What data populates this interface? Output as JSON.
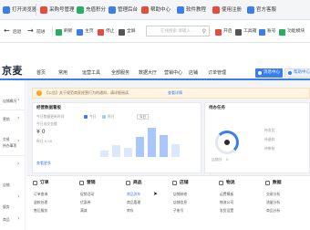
{
  "favorites": [
    {
      "label": "打开浏览器",
      "color": "#3a7cf2"
    },
    {
      "label": "采购号管理",
      "color": "#e64b3c"
    },
    {
      "label": "充值积分",
      "color": "#27ae60"
    },
    {
      "label": "管理后台",
      "color": "#3a7cf2"
    },
    {
      "label": "帮助中心",
      "color": "#e64b3c"
    },
    {
      "label": "软件教程",
      "color": "#3a7cf2"
    },
    {
      "label": "使用注册",
      "color": "#e64b3c"
    },
    {
      "label": "官方客服",
      "color": "#3a7cf2"
    }
  ],
  "toolbar": {
    "back_label": "后退",
    "forward_label": "前进",
    "items": [
      {
        "label": "刷新",
        "color": "#27ae60"
      },
      {
        "label": "主页",
        "color": "#3a7cf2"
      },
      {
        "label": "停止",
        "color": "#e64b3c"
      },
      {
        "label": "全屏",
        "color": "#555555"
      }
    ],
    "search_placeholder": "在线搜索·请输入...",
    "right_items": [
      {
        "label": "开启",
        "color": "#e64b3c"
      },
      {
        "label": "工具箱",
        "color": "#555555"
      },
      {
        "label": "账号",
        "color": "#3a7cf2"
      },
      {
        "label": "功能模块",
        "color": "#27ae60"
      }
    ]
  },
  "header": {
    "logo": "京麦",
    "nav": [
      "首页",
      "常用",
      "运营工具",
      "全部服务",
      "数据大厅",
      "营销中心",
      "店铺",
      "订单管理"
    ],
    "primary_button": "消息中心",
    "secondary_button": "帮助中心"
  },
  "sidebar": {
    "items": [
      "店铺概况",
      "营销",
      "交易",
      "待办事项",
      "店铺",
      "服务",
      "商品",
      "发票"
    ]
  },
  "notice": {
    "text": "【公告】关于规范商家经营行为的通知，请详细阅读",
    "link": "查看详情"
  },
  "overview": {
    "title": "经营数据看板",
    "subtitle": "今日数据更新时间",
    "metric_label": "今日成交金额",
    "metric_value": "¥ 0",
    "metric_sub": "昨日 0.00",
    "legend": [
      "今日",
      "昨日"
    ],
    "bars": [
      0.18,
      0.32,
      0.25,
      0.55,
      0.8,
      0.6,
      0.35
    ],
    "link": "查看更多"
  },
  "tasks": {
    "title": "待办任务",
    "gauge_label": "店铺分",
    "gauge_value": "0",
    "items": [
      "待发货",
      "待退款",
      "待审核"
    ]
  },
  "menu": {
    "columns": [
      {
        "title": "订单",
        "items": [
          "订单查询",
          "退款处理",
          "售后服务"
        ]
      },
      {
        "title": "营销",
        "items": [
          "促销活动",
          "优惠券",
          "满减"
        ]
      },
      {
        "title": "商品",
        "items": [
          "商品发布",
          "商品管理",
          "库存"
        ]
      },
      {
        "title": "店铺",
        "items": [
          "店铺装修",
          "店铺信息",
          "子账号"
        ]
      },
      {
        "title": "物流",
        "items": [
          "运费模板",
          "物流公司",
          "发货设置"
        ]
      },
      {
        "title": "数据",
        "items": [
          "交易分析",
          "流量分析",
          "商品分析"
        ]
      }
    ],
    "active_item": "商品发布"
  }
}
